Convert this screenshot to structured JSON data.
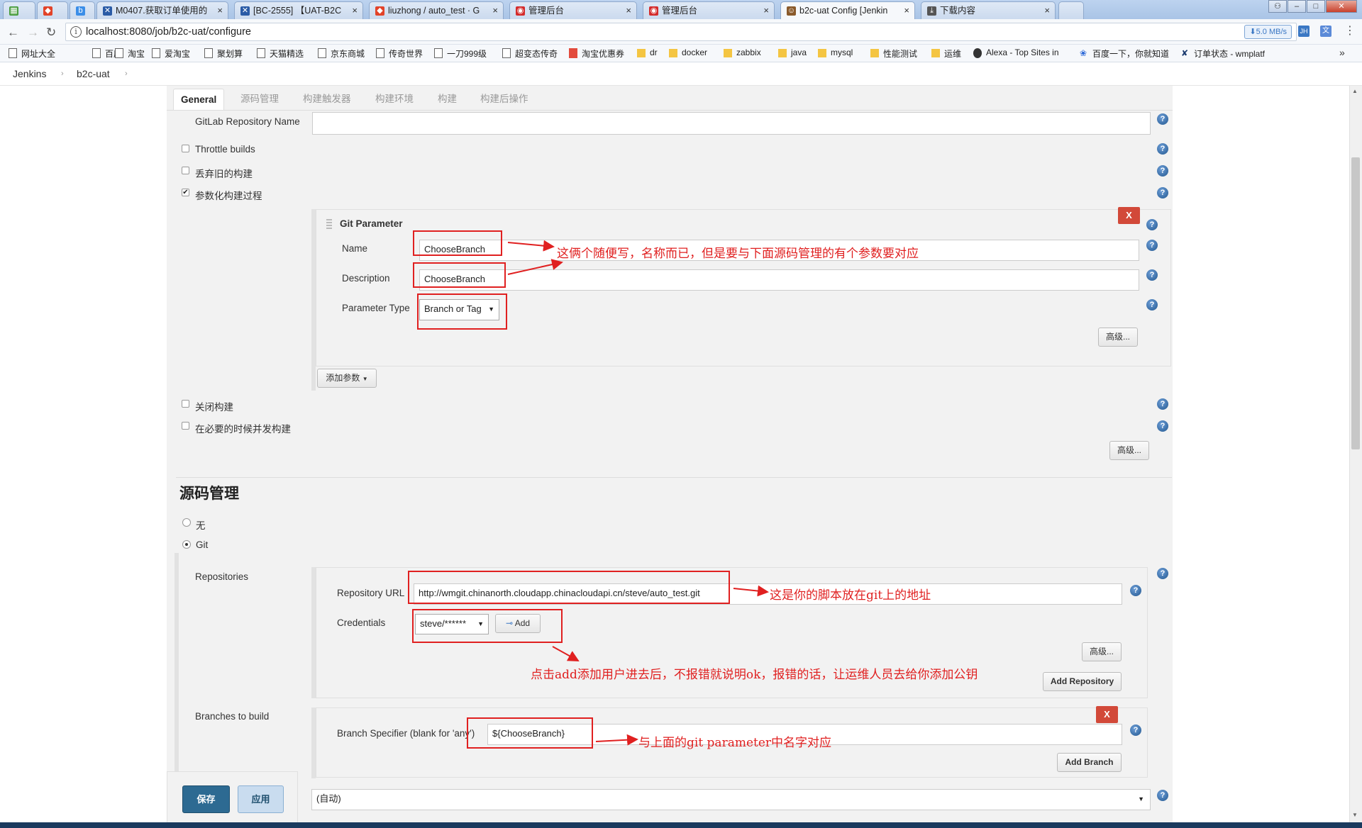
{
  "browser": {
    "tabs": [
      {
        "label": "",
        "icon": "spreadsheet-icon",
        "color": "#4a9d3f"
      },
      {
        "label": "",
        "icon": "gitlab-icon",
        "color": "#e24329"
      },
      {
        "label": "",
        "icon": "bing-icon",
        "color": "#3b8ee8"
      },
      {
        "label": "M0407.获取订单使用的",
        "icon": "jira-icon",
        "color": "#2a5ba6"
      },
      {
        "label": "[BC-2555] 【UAT-B2C",
        "icon": "jira-icon",
        "color": "#2a5ba6"
      },
      {
        "label": "liuzhong / auto_test · G",
        "icon": "gitlab-icon",
        "color": "#e24329"
      },
      {
        "label": "管理后台",
        "icon": "weibo-icon",
        "color": "#d42b2b"
      },
      {
        "label": "管理后台",
        "icon": "weibo-icon",
        "color": "#d42b2b"
      },
      {
        "label": "b2c-uat Config [Jenkin",
        "icon": "jenkins-icon",
        "color": "#8a5a2b"
      },
      {
        "label": "下载内容",
        "icon": "download-icon",
        "color": "#555555"
      }
    ],
    "url": "localhost:8080/job/b2c-uat/configure",
    "download_speed": "⬇5.0 MB/s",
    "bookmarks": [
      {
        "label": "网址大全",
        "icon": "page"
      },
      {
        "label": "百度",
        "icon": "page"
      },
      {
        "label": "淘宝",
        "icon": "page"
      },
      {
        "label": "爱淘宝",
        "icon": "page"
      },
      {
        "label": "聚划算",
        "icon": "page"
      },
      {
        "label": "天猫精选",
        "icon": "page"
      },
      {
        "label": "京东商城",
        "icon": "page"
      },
      {
        "label": "传奇世界",
        "icon": "page"
      },
      {
        "label": "一刀999级",
        "icon": "page"
      },
      {
        "label": "超变态传奇",
        "icon": "page"
      },
      {
        "label": "淘宝优惠券",
        "icon": "red"
      },
      {
        "label": "dr",
        "icon": "folder"
      },
      {
        "label": "docker",
        "icon": "folder"
      },
      {
        "label": "zabbix",
        "icon": "folder"
      },
      {
        "label": "java",
        "icon": "folder"
      },
      {
        "label": "mysql",
        "icon": "folder"
      },
      {
        "label": "性能测试",
        "icon": "folder"
      },
      {
        "label": "运维",
        "icon": "folder"
      },
      {
        "label": "Alexa - Top Sites in",
        "icon": "round"
      },
      {
        "label": "百度一下，你就知道",
        "icon": "paw"
      },
      {
        "label": "订单状态 - wmplatf",
        "icon": "x"
      }
    ],
    "more_bookmarks": "»"
  },
  "breadcrumb": {
    "root": "Jenkins",
    "job": "b2c-uat",
    "sep": "›"
  },
  "config_tabs": [
    "General",
    "源码管理",
    "构建触发器",
    "构建环境",
    "构建",
    "构建后操作"
  ],
  "general": {
    "gitlab_repo_label": "GitLab Repository Name",
    "gitlab_repo_value": "",
    "throttle": {
      "label": "Throttle builds",
      "checked": false
    },
    "discard": {
      "label": "丢弃旧的构建",
      "checked": false
    },
    "parameterized": {
      "label": "参数化构建过程",
      "checked": true
    },
    "git_param": {
      "title": "Git Parameter",
      "remove": "X",
      "name_label": "Name",
      "name_value": "ChooseBranch",
      "desc_label": "Description",
      "desc_value": "ChooseBranch",
      "type_label": "Parameter Type",
      "type_value": "Branch or Tag",
      "advanced": "高级..."
    },
    "add_param": "添加参数",
    "disable_build": {
      "label": "关闭构建",
      "checked": false
    },
    "concurrent": {
      "label": "在必要的时候并发构建",
      "checked": false
    },
    "advanced": "高级..."
  },
  "scm": {
    "title": "源码管理",
    "none_label": "无",
    "git_label": "Git",
    "repositories_label": "Repositories",
    "repo_url_label": "Repository URL",
    "repo_url_value": "http://wmgit.chinanorth.cloudapp.chinacloudapi.cn/steve/auto_test.git",
    "credentials_label": "Credentials",
    "credentials_value": "steve/******",
    "add_cred": "Add",
    "advanced": "高级...",
    "add_repository": "Add Repository",
    "branches_label": "Branches to build",
    "branch_spec_label": "Branch Specifier (blank for 'any')",
    "branch_spec_value": "${ChooseBranch}",
    "remove": "X",
    "add_branch": "Add Branch",
    "browser_value": "(自动)"
  },
  "annotations": {
    "name_note": "这俩个随便写，名称而已，但是要与下面源码管理的有个参数要对应",
    "url_note": "这是你的脚本放在git上的地址",
    "cred_note": "点击add添加用户进去后，不报错就说明ok，报错的话，让运维人员去给你添加公钥",
    "branch_note": "与上面的git parameter中名字对应",
    "color": "#e02020"
  },
  "actions": {
    "save": "保存",
    "apply": "应用"
  },
  "help_glyph": "?"
}
